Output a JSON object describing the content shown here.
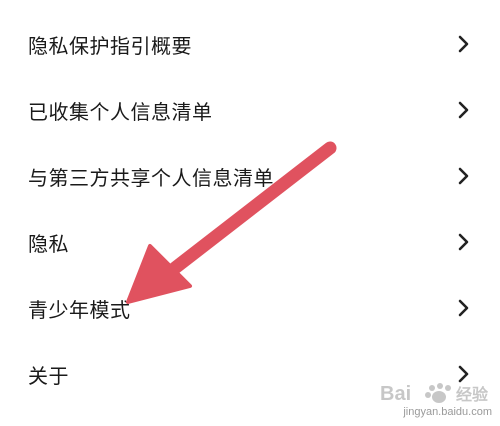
{
  "menu": {
    "items": [
      {
        "label": "隐私保护指引概要"
      },
      {
        "label": "已收集个人信息清单"
      },
      {
        "label": "与第三方共享个人信息清单"
      },
      {
        "label": "隐私"
      },
      {
        "label": "青少年模式"
      },
      {
        "label": "关于"
      }
    ]
  },
  "icons": {
    "chevron": "chevron-right-icon"
  },
  "colors": {
    "arrow": "#e0525f",
    "text": "#1a1a1a",
    "chevron": "#222222"
  },
  "watermark": {
    "brand": "Bai 百度 经验",
    "url": "jingyan.baidu.com"
  }
}
